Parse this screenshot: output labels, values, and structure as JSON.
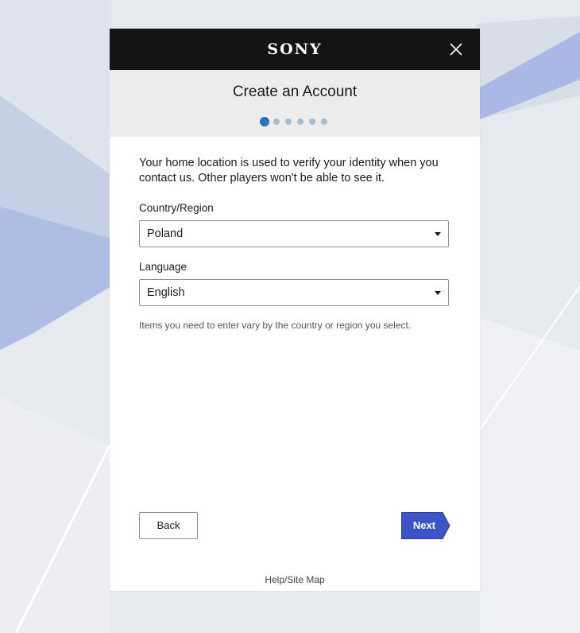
{
  "dialog": {
    "brand": "SONY",
    "title": "Create an Account",
    "steps": {
      "total": 6,
      "current": 1
    },
    "intro": "Your home location is used to verify your identity when you contact us. Other players won't be able to see it.",
    "country": {
      "label": "Country/Region",
      "value": "Poland"
    },
    "language": {
      "label": "Language",
      "value": "English"
    },
    "note": "Items you need to enter vary by the country or region you select.",
    "back_label": "Back",
    "next_label": "Next",
    "footer_link": "Help/Site Map"
  },
  "colors": {
    "topbar": "#141414",
    "header": "#ececec",
    "accent": "#3b55c8",
    "step_active": "#2d6fc0",
    "step_inactive": "#a6bdd0"
  },
  "icons": {
    "close": "close-icon",
    "dropdown": "chevron-down-icon"
  }
}
